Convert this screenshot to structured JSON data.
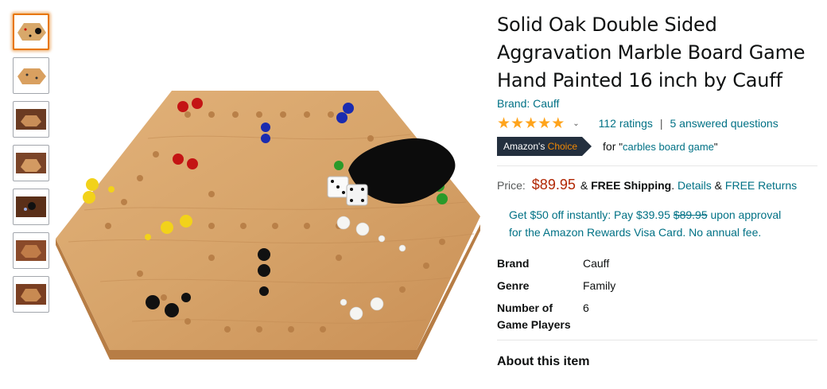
{
  "product": {
    "title": "Solid Oak Double Sided Aggravation Marble Board Game Hand Painted 16 inch by Cauff",
    "brand_link": "Brand: Cauff",
    "rating_stars": 5,
    "ratings_count": "112 ratings",
    "separator": "|",
    "answered_questions": "5 answered questions",
    "badge_prefix": "Amazon's",
    "badge_choice": "Choice",
    "choice_for": "for",
    "choice_keyword_open": "\"",
    "choice_keyword": "carbles board game",
    "choice_keyword_close": "\""
  },
  "price": {
    "label": "Price:",
    "value": "$89.95",
    "amp1": "&",
    "shipping": "FREE Shipping",
    "period": ".",
    "details": "Details",
    "amp2": "&",
    "returns": "FREE Returns"
  },
  "offer": {
    "text_a": "Get $50 off instantly: Pay $39.95",
    "strike": "$89.95",
    "text_b": "upon approval for the Amazon Rewards Visa Card. No annual fee."
  },
  "specs": [
    {
      "key": "Brand",
      "value": "Cauff"
    },
    {
      "key": "Genre",
      "value": "Family"
    },
    {
      "key": "Number of Game Players",
      "value": "6"
    }
  ],
  "about_heading": "About this item",
  "thumbnails": [
    "thumbnail-1",
    "thumbnail-2",
    "thumbnail-3",
    "thumbnail-4",
    "thumbnail-5",
    "thumbnail-6",
    "thumbnail-7"
  ],
  "colors": {
    "link": "#007185",
    "price": "#b12704",
    "star": "#ffa41c",
    "badge_bg": "#232f3e",
    "badge_choice": "#f08804",
    "thumb_selected_border": "#e77600"
  }
}
